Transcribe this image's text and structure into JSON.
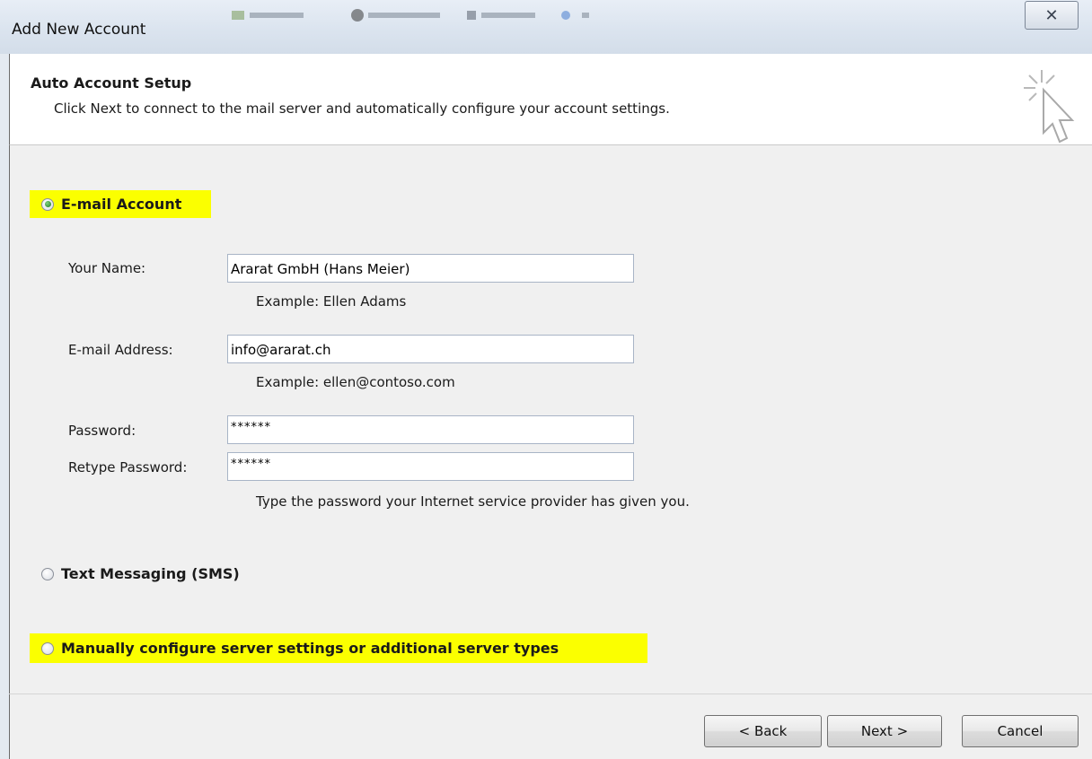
{
  "window": {
    "title": "Add New Account",
    "close_glyph": "✕"
  },
  "header": {
    "title": "Auto Account Setup",
    "subtitle": "Click Next to connect to the mail server and automatically configure your account settings."
  },
  "options": {
    "email_account": {
      "label": "E-mail Account",
      "selected": true
    },
    "sms": {
      "label": "Text Messaging (SMS)",
      "selected": false
    },
    "manual": {
      "label": "Manually configure server settings or additional server types",
      "selected": false
    }
  },
  "form": {
    "name": {
      "label": "Your Name:",
      "value": "Ararat GmbH (Hans Meier)",
      "hint": "Example: Ellen Adams"
    },
    "email": {
      "label": "E-mail Address:",
      "value": "info@ararat.ch",
      "hint": "Example: ellen@contoso.com"
    },
    "password": {
      "label": "Password:",
      "value": "******"
    },
    "retype": {
      "label": "Retype Password:",
      "value": "******"
    },
    "password_hint": "Type the password your Internet service provider has given you."
  },
  "buttons": {
    "back": "< Back",
    "next": "Next >",
    "cancel": "Cancel"
  },
  "colors": {
    "highlight": "#fbff00",
    "radio_selected": "#2e8b2e",
    "input_border": "#a8b4c6"
  },
  "icons": {
    "wizard": "cursor-sparkle-icon",
    "close": "close-icon"
  }
}
